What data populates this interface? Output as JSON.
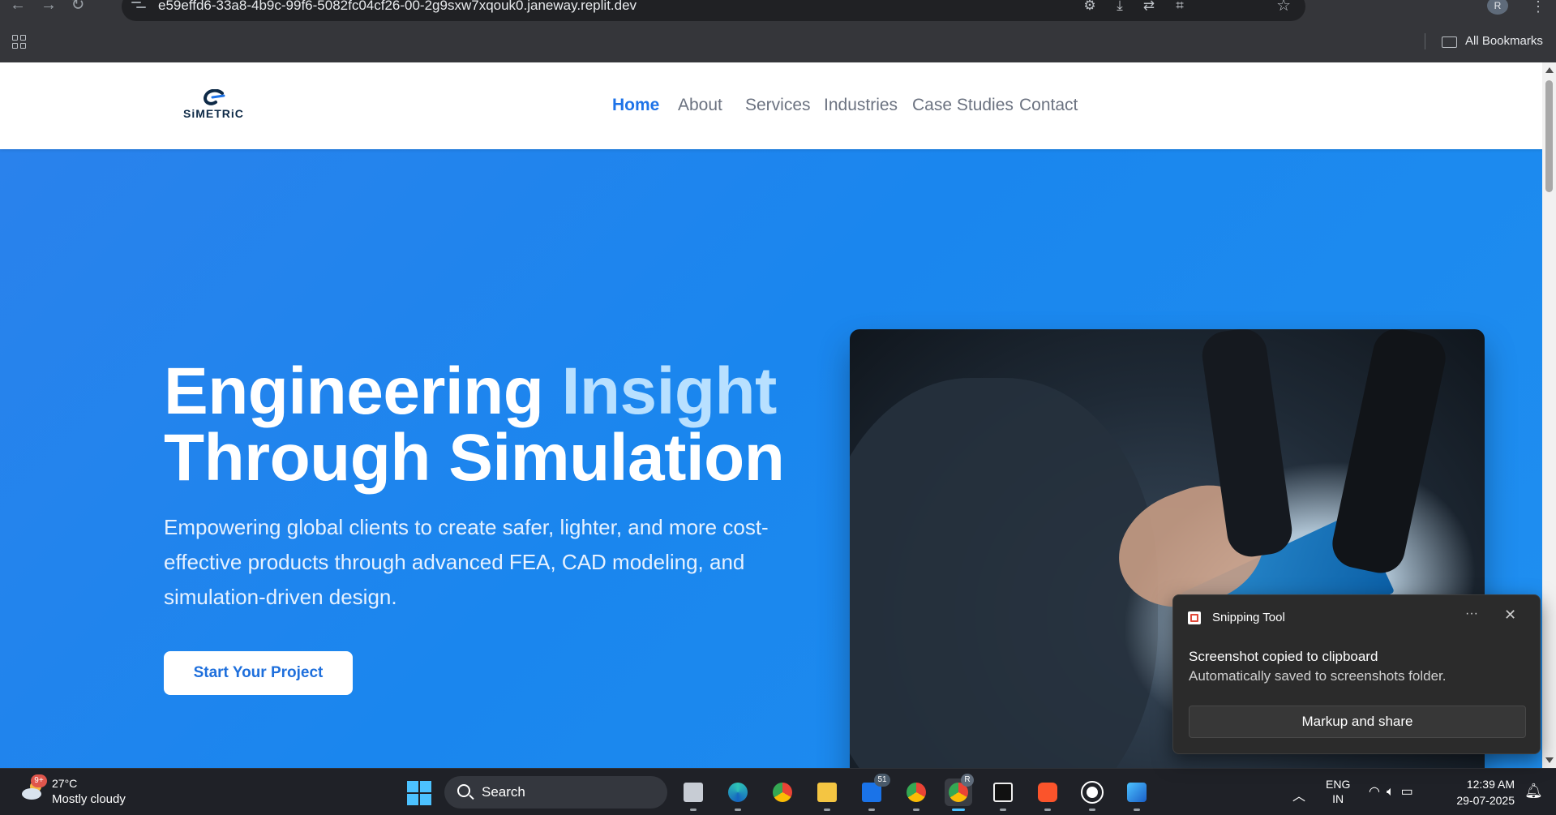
{
  "browser": {
    "url": "e59effd6-33a8-4b9c-99f6-5082fc04cf26-00-2g9sxw7xqouk0.janeway.replit.dev",
    "profile_initial": "R",
    "bookmarks_label": "All Bookmarks"
  },
  "site": {
    "logo_text": "SiMETRiC",
    "nav": [
      {
        "label": "Home",
        "active": true
      },
      {
        "label": "About",
        "active": false
      },
      {
        "label": "Services",
        "active": false
      },
      {
        "label": "Industries",
        "active": false
      },
      {
        "label": "Case Studies",
        "active": false
      },
      {
        "label": "Contact",
        "active": false
      }
    ],
    "hero": {
      "title_part1": "Engineering ",
      "title_accent": "Insight",
      "title_part2": "Through Simulation",
      "subtitle": "Empowering global clients to create safer, lighter, and more cost-effective products through advanced FEA, CAD modeling, and simulation-driven design.",
      "cta_label": "Start Your Project"
    },
    "colors": {
      "accent": "#1e73e8",
      "hero_bg": "#1a86ee",
      "title_accent": "#b8e0ff"
    }
  },
  "notification": {
    "app_name": "Snipping Tool",
    "title": "Screenshot copied to clipboard",
    "body": "Automatically saved to screenshots folder.",
    "action_label": "Markup and share",
    "more_glyph": "···",
    "close_glyph": "✕"
  },
  "taskbar": {
    "weather_badge": "9+",
    "temperature": "27°C",
    "condition": "Mostly cloudy",
    "search_placeholder": "Search",
    "mail_badge": "51",
    "chrome_profile_badge": "R",
    "language_line1": "ENG",
    "language_line2": "IN",
    "time": "12:39 AM",
    "date": "29-07-2025"
  }
}
